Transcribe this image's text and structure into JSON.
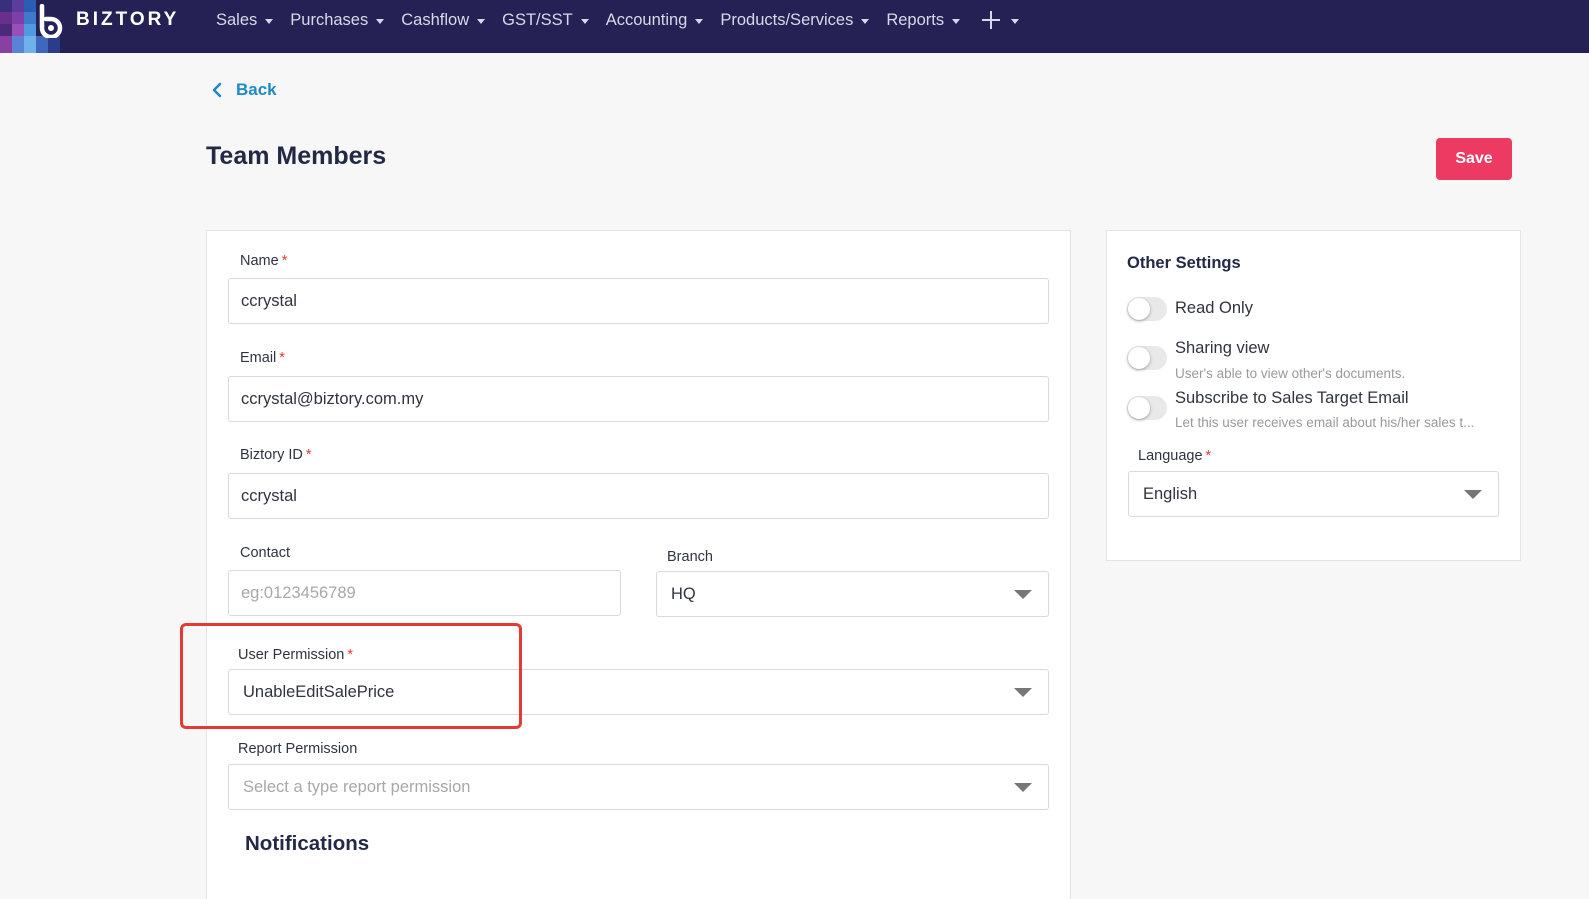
{
  "brand": {
    "name": "BIZTORY"
  },
  "nav": {
    "items": [
      {
        "label": "Sales"
      },
      {
        "label": "Purchases"
      },
      {
        "label": "Cashflow"
      },
      {
        "label": "GST/SST"
      },
      {
        "label": "Accounting"
      },
      {
        "label": "Products/Services"
      },
      {
        "label": "Reports"
      }
    ],
    "plus_icon": "plus-icon"
  },
  "back": {
    "label": "Back",
    "icon": "chevron-left-icon"
  },
  "page": {
    "title": "Team Members"
  },
  "actions": {
    "save_label": "Save"
  },
  "form": {
    "name": {
      "label": "Name",
      "required": "*",
      "value": "ccrystal"
    },
    "email": {
      "label": "Email",
      "required": "*",
      "value": "ccrystal@biztory.com.my"
    },
    "biztory_id": {
      "label": "Biztory ID",
      "required": "*",
      "value": "ccrystal"
    },
    "contact": {
      "label": "Contact",
      "placeholder": "eg:0123456789"
    },
    "branch": {
      "label": "Branch",
      "value": "HQ"
    },
    "user_permission": {
      "label": "User Permission",
      "required": "*",
      "value": "UnableEditSalePrice"
    },
    "report_permission": {
      "label": "Report Permission",
      "placeholder": "Select a type report permission"
    },
    "notifications_title": "Notifications"
  },
  "other_settings": {
    "title": "Other Settings",
    "toggles": [
      {
        "label": "Read Only",
        "on": false
      },
      {
        "label": "Sharing view",
        "description": "User's able to view other's documents.",
        "on": false
      },
      {
        "label": "Subscribe to Sales Target Email",
        "description": "Let this user receives email about his/her sales t...",
        "on": false
      }
    ],
    "language": {
      "label": "Language",
      "required": "*",
      "value": "English"
    }
  },
  "colors": {
    "nav_bg": "#252154",
    "accent_link": "#1e88c9",
    "save_button": "#ec3a63",
    "highlight": "#e53935"
  }
}
